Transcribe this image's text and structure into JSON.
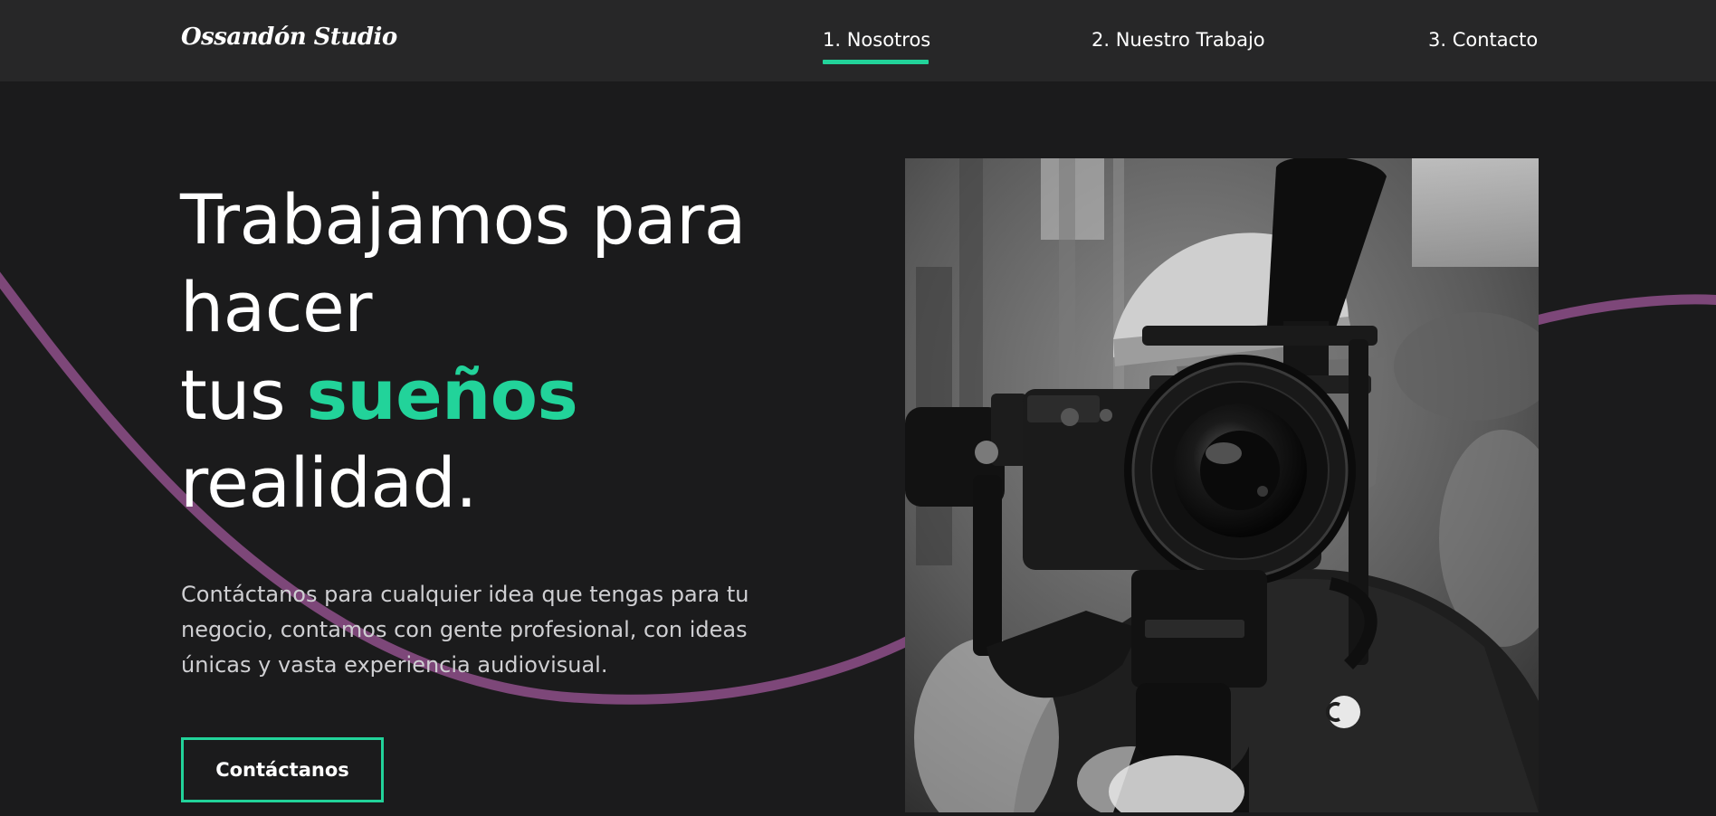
{
  "brand": {
    "name": "Ossandón Studio"
  },
  "nav": {
    "items": [
      {
        "label": "1. Nosotros",
        "active": true
      },
      {
        "label": "2. Nuestro Trabajo",
        "active": false
      },
      {
        "label": "3. Contacto",
        "active": false
      }
    ]
  },
  "hero": {
    "headline": {
      "line1": "Trabajamos para",
      "line2": "hacer",
      "line3_prefix": "tus ",
      "line3_highlight": "sueños",
      "line4": "realidad."
    },
    "description": "Contáctanos para cualquier idea que tengas para tu negocio, contamos con gente profesional, con ideas únicas y vasta experiencia audiovisual.",
    "cta_label": "Contáctanos",
    "photo_subject": "camera-operator-photo"
  },
  "colors": {
    "background": "#1b1b1c",
    "navbar": "#272728",
    "accent": "#22d39a",
    "wave": "#7d4779",
    "text": "#ffffff",
    "muted_text": "#cfcfd2"
  }
}
